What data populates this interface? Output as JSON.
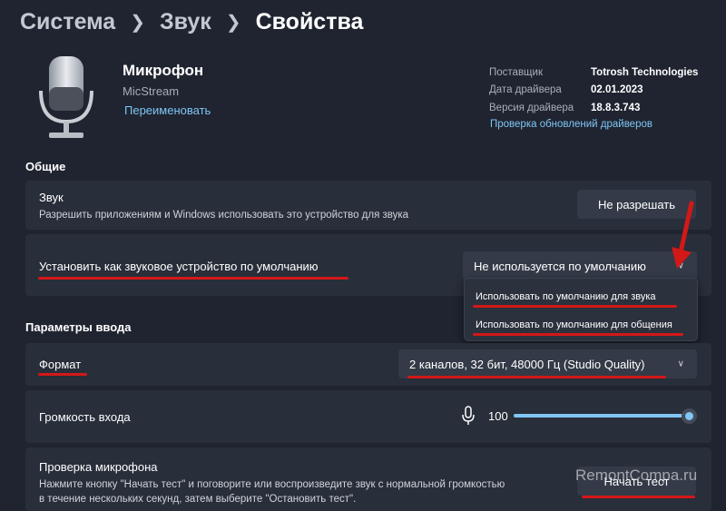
{
  "breadcrumb": {
    "root": "Система",
    "parent": "Звук",
    "current": "Свойства"
  },
  "device": {
    "name": "Микрофон",
    "stream": "MicStream",
    "rename": "Переименовать",
    "icon": "microphone-icon"
  },
  "driver": {
    "vendor_label": "Поставщик",
    "vendor": "Totrosh Technologies",
    "date_label": "Дата драйвера",
    "date": "02.01.2023",
    "version_label": "Версия драйвера",
    "version": "18.8.3.743",
    "update_link": "Проверка обновлений драйверов"
  },
  "general": {
    "title": "Общие",
    "sound": {
      "title": "Звук",
      "desc": "Разрешить приложениям и Windows использовать это устройство для звука",
      "button": "Не разрешать"
    },
    "default_device": {
      "title": "Установить как звуковое устройство по умолчанию",
      "selected": "Не используется по умолчанию",
      "options": [
        "Использовать по умолчанию для звука",
        "Использовать по умолчанию для общения"
      ]
    }
  },
  "input": {
    "title": "Параметры ввода",
    "format": {
      "title": "Формат",
      "selected": "2 каналов, 32 бит, 48000 Гц (Studio Quality)"
    },
    "volume": {
      "title": "Громкость входа",
      "value": "100",
      "level": 100
    },
    "test": {
      "title": "Проверка микрофона",
      "desc1": "Нажмите кнопку \"Начать тест\" и поговорите или воспроизведите звук с нормальной громкостью",
      "desc2": "в течение нескольких секунд, затем выберите \"Остановить тест\".",
      "button": "Начать тест"
    }
  },
  "watermark": "RemontCompa.ru",
  "colors": {
    "accent": "#7fc6f5",
    "annotation": "#d31818",
    "background": "#1f2430",
    "card": "#282e3a"
  }
}
